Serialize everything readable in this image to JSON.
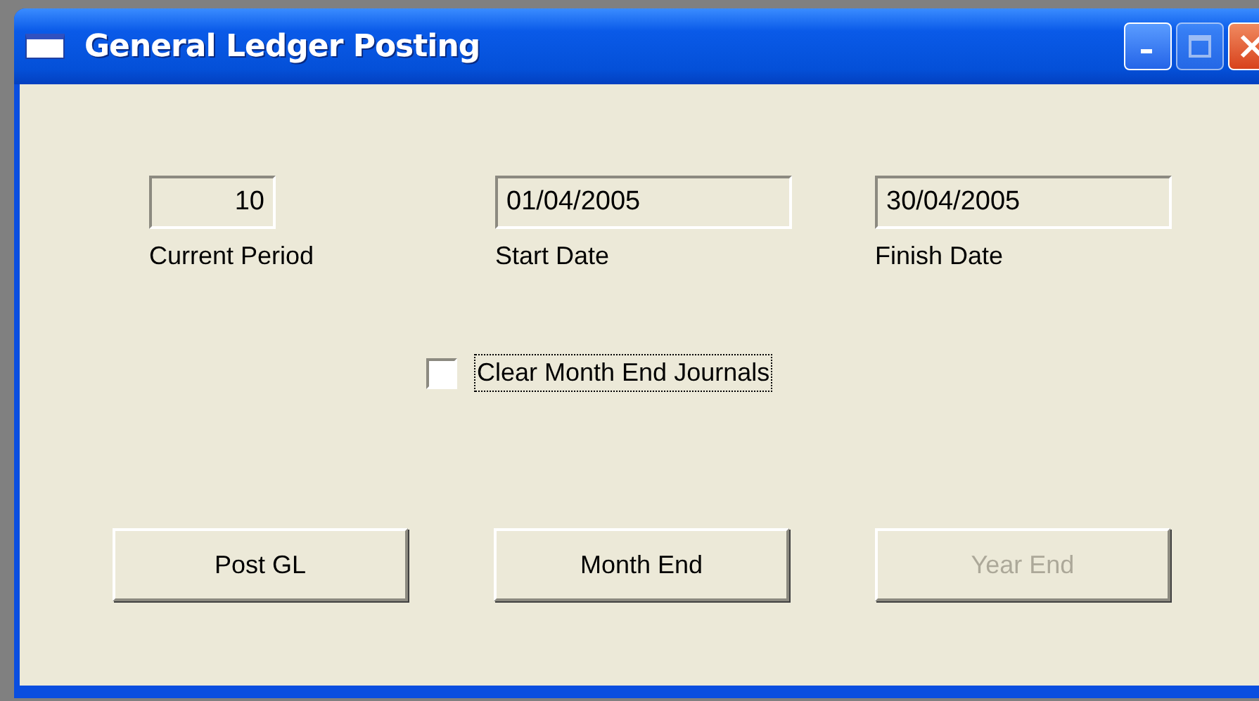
{
  "window": {
    "title": "General Ledger Posting"
  },
  "fields": [
    {
      "kind": "number",
      "value": "10",
      "label": "Current Period"
    },
    {
      "kind": "date",
      "value": "01/04/2005",
      "label": "Start Date"
    },
    {
      "kind": "date",
      "value": "30/04/2005",
      "label": "Finish Date"
    }
  ],
  "checkbox": {
    "label": "Clear Month End Journals",
    "checked": false,
    "focused": true
  },
  "buttons": [
    {
      "label": "Post GL",
      "disabled": false
    },
    {
      "label": "Month End",
      "disabled": false
    },
    {
      "label": "Year End",
      "disabled": true
    }
  ]
}
